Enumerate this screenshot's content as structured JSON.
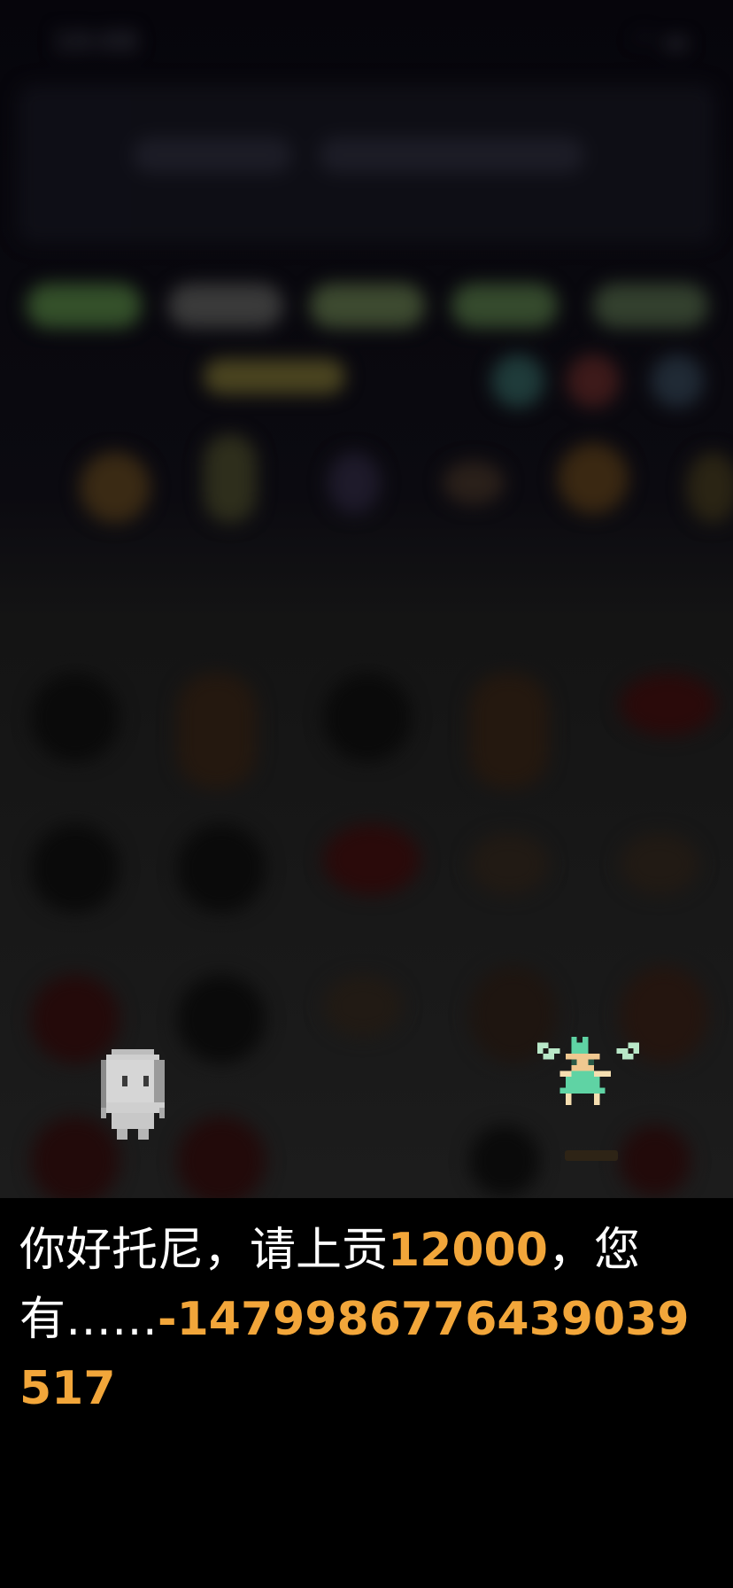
{
  "status_bar": {
    "time": "10:08",
    "icons": "wifi-icon battery-icon"
  },
  "dialog": {
    "part1": "你好托尼，请上贡",
    "amount": "12000",
    "part2": "，您有……",
    "balance": "-1479986776439039517"
  },
  "colors": {
    "highlight": "#f2a63a",
    "text": "#ffffff",
    "dialog_bg": "#000000",
    "fairy": "#5fd3a4"
  }
}
